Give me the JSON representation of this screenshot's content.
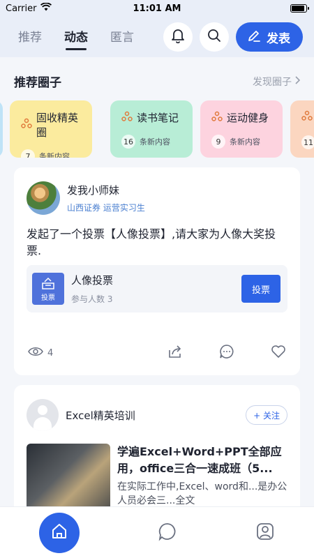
{
  "status_bar": {
    "carrier": "Carrier",
    "time": "11:01 AM"
  },
  "header": {
    "tabs": [
      {
        "label": "推荐",
        "active": false
      },
      {
        "label": "动态",
        "active": true
      },
      {
        "label": "匿言",
        "active": false
      }
    ],
    "publish_label": "发表"
  },
  "circles": {
    "title": "推荐圈子",
    "discover_label": "发现圈子",
    "items": [
      {
        "name": "固收精英圈",
        "count": "7",
        "meta": "条新内容",
        "bg": "#fbeb9e"
      },
      {
        "name": "读书笔记",
        "count": "16",
        "meta": "条新内容",
        "bg": "#b8edd6"
      },
      {
        "name": "运动健身",
        "count": "9",
        "meta": "条新内容",
        "bg": "#fdd3df"
      },
      {
        "name": "",
        "count": "11",
        "meta": "",
        "bg": "#fbd6c0"
      }
    ]
  },
  "post1": {
    "author": "发我小师妹",
    "subtitle": "山西证券 运营实习生",
    "text": "发起了一个投票【人像投票】,请大家为人像大奖投票.",
    "vote": {
      "icon_label": "投票",
      "title": "人像投票",
      "participants": "参与人数 3",
      "button": "投票"
    },
    "views": "4"
  },
  "post2": {
    "author": "Excel精英培训",
    "follow_label": "+ 关注",
    "course_title": "学遍Excel+Word+PPT全部应用，office三合一速成班（5...",
    "course_desc": "在实际工作中,Excel、word和...是办公人员必会三...全文"
  },
  "colors": {
    "accent": "#2d63e6",
    "background": "#f4f6fa"
  }
}
